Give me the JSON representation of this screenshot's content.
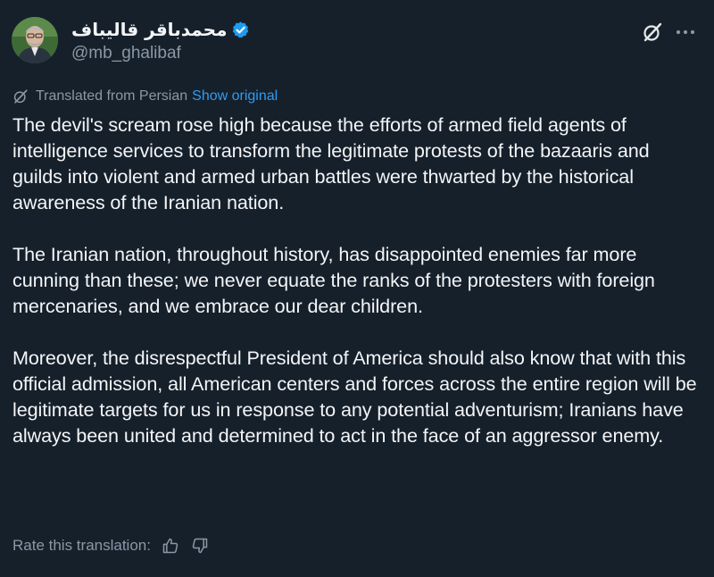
{
  "tweet": {
    "display_name": "محمدباقر قالیباف",
    "handle": "@mb_ghalibaf",
    "verified": true,
    "avatar_icon": "profile-photo",
    "actions": {
      "grok_icon": "grok-icon",
      "more_icon": "more-dots-icon"
    }
  },
  "translation": {
    "icon": "translate-icon",
    "label": "Translated from Persian",
    "show_original_label": "Show original"
  },
  "body": {
    "paragraphs": [
      "The devil's scream rose high because the efforts of armed field agents of intelligence services to transform the legitimate protests of the bazaaris and guilds into violent and armed urban battles were thwarted by the historical awareness of the Iranian nation.",
      "The Iranian nation, throughout history, has disappointed enemies far more cunning than these; we never equate the ranks of the protesters with foreign mercenaries, and we embrace our dear children.",
      "Moreover, the disrespectful President of America should also know that with this official admission, all American centers and forces across the entire region will be legitimate targets for us in response to any potential adventurism; Iranians have always been united and determined to act in the face of an aggressor enemy."
    ]
  },
  "rating": {
    "label": "Rate this translation:",
    "thumbs_up_icon": "thumbs-up-icon",
    "thumbs_down_icon": "thumbs-down-icon"
  },
  "colors": {
    "background": "#16202b",
    "text_primary": "#f3f5f7",
    "text_secondary": "#8a98a6",
    "link": "#2f9cf2",
    "verified_badge": "#1d9bf0"
  }
}
